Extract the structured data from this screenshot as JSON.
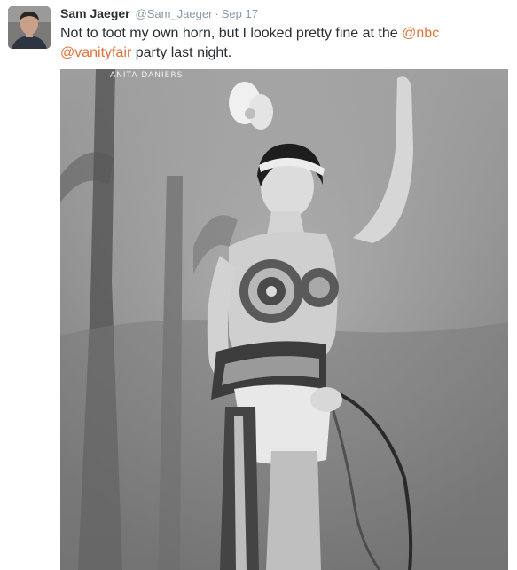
{
  "tweet": {
    "display_name": "Sam Jaeger",
    "handle": "@Sam_Jaeger",
    "separator": "·",
    "date": "Sep 17",
    "text_part1": "Not to toot my own horn, but I looked pretty fine at the ",
    "mention_nbc": "@nbc",
    "mention_vanityfair": "@vanityfair",
    "text_part2": " party last night."
  },
  "photo": {
    "caption": "ANITA DANIERS"
  },
  "colors": {
    "link": "#e0733a",
    "name": "#292f33",
    "meta": "#8899a6"
  }
}
